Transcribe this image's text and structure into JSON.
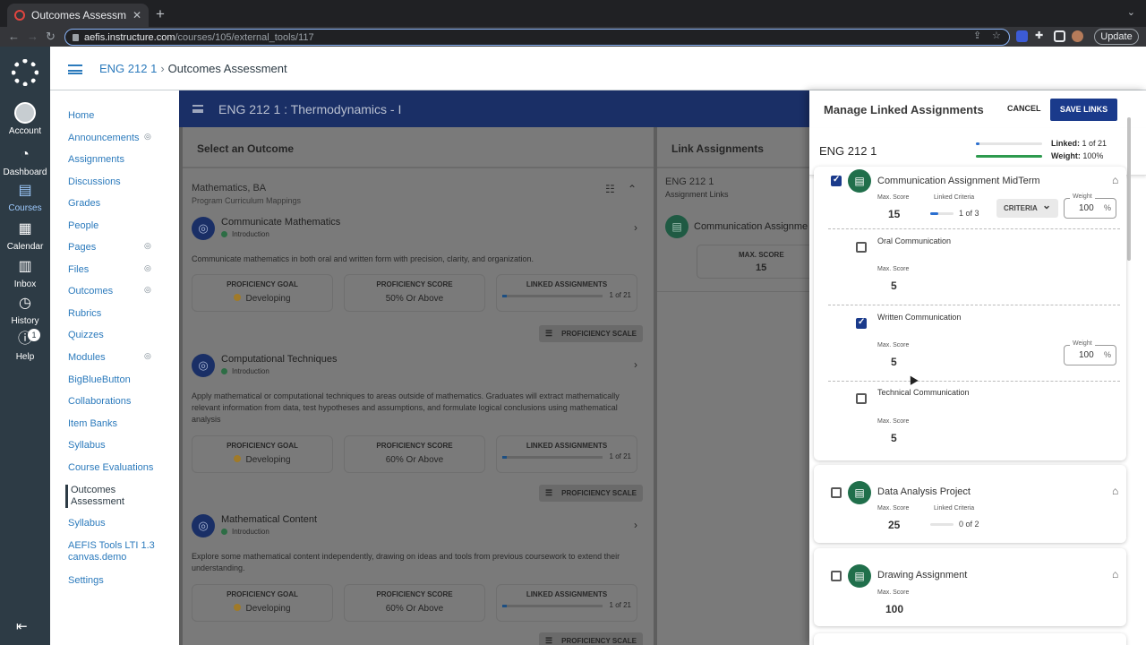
{
  "browser": {
    "tab_title": "Outcomes Assessment",
    "url_host": "aefis.instructure.com",
    "url_path": "/courses/105/external_tools/117",
    "update_label": "Update"
  },
  "global_nav": {
    "account": "Account",
    "dashboard": "Dashboard",
    "courses": "Courses",
    "calendar": "Calendar",
    "inbox": "Inbox",
    "history": "History",
    "help": "Help",
    "help_badge": "1"
  },
  "breadcrumb": {
    "course": "ENG 212 1",
    "separator": "›",
    "page": "Outcomes Assessment"
  },
  "course_nav": [
    {
      "label": "Home"
    },
    {
      "label": "Announcements"
    },
    {
      "label": "Assignments"
    },
    {
      "label": "Discussions"
    },
    {
      "label": "Grades"
    },
    {
      "label": "People"
    },
    {
      "label": "Pages"
    },
    {
      "label": "Files"
    },
    {
      "label": "Outcomes"
    },
    {
      "label": "Rubrics"
    },
    {
      "label": "Quizzes"
    },
    {
      "label": "Modules"
    },
    {
      "label": "BigBlueButton"
    },
    {
      "label": "Collaborations"
    },
    {
      "label": "Item Banks"
    },
    {
      "label": "Syllabus"
    },
    {
      "label": "Course Evaluations"
    },
    {
      "label": "Outcomes Assessment"
    },
    {
      "label": "Syllabus"
    },
    {
      "label": "AEFIS Tools LTI 1.3 canvas.demo"
    },
    {
      "label": "Settings"
    }
  ],
  "app_bar": {
    "title": "ENG 212 1 : Thermodynamics - I"
  },
  "left_panel": {
    "title": "Select an Outcome",
    "program": "Mathematics, BA",
    "program_sub": "Program Curriculum Mappings",
    "labels": {
      "goal": "PROFICIENCY GOAL",
      "score": "PROFICIENCY SCORE",
      "linked": "LINKED ASSIGNMENTS",
      "scale": "PROFICIENCY SCALE"
    },
    "outcomes": [
      {
        "title": "Communicate Mathematics",
        "level": "Introduction",
        "description": "Communicate mathematics in both oral and written form with precision, clarity, and organization.",
        "goal": "Developing",
        "score": "50% Or Above",
        "linked": "1 of 21",
        "linked_fraction": 0.048
      },
      {
        "title": "Computational Techniques",
        "level": "Introduction",
        "description": "Apply mathematical or computational techniques to areas outside of mathematics. Graduates will extract mathematically relevant information from data, test hypotheses and assumptions, and formulate logical conclusions using mathematical analysis",
        "goal": "Developing",
        "score": "60% Or Above",
        "linked": "1 of 21",
        "linked_fraction": 0.048
      },
      {
        "title": "Mathematical Content",
        "level": "Introduction",
        "description": "Explore some mathematical content independently, drawing on ideas and tools from previous coursework to extend their understanding.",
        "goal": "Developing",
        "score": "60% Or Above",
        "linked": "1 of 21",
        "linked_fraction": 0.048
      }
    ]
  },
  "right_panel": {
    "title": "Link Assignments",
    "course": "ENG 212 1",
    "sub": "Assignment Links",
    "assignment": "Communication Assignme",
    "max_label": "MAX. SCORE",
    "max_value": "15"
  },
  "drawer": {
    "title": "Manage Linked Assignments",
    "cancel": "CANCEL",
    "save": "SAVE LINKS",
    "course": "ENG 212 1",
    "linked_label": "Linked:",
    "linked_value": "1 of 21",
    "linked_fraction": 0.048,
    "weight_label": "Weight:",
    "weight_value": "100%",
    "weight_fraction": 1.0,
    "max_label": "Max. Score",
    "linked_criteria_label": "Linked Criteria",
    "weight_field_label": "Weight",
    "percent": "%",
    "criteria_button": "CRITERIA",
    "assignments": [
      {
        "title": "Communication Assignment MidTerm",
        "checked": true,
        "max": "15",
        "criteria": "1 of 3",
        "criteria_fraction": 0.33,
        "weight": "100",
        "criteria_items": [
          {
            "title": "Oral Communication",
            "checked": false,
            "max": "5"
          },
          {
            "title": "Written Communication",
            "checked": true,
            "max": "5",
            "weight": "100"
          },
          {
            "title": "Technical Communication",
            "checked": false,
            "max": "5"
          }
        ]
      },
      {
        "title": "Data Analysis Project",
        "checked": false,
        "max": "25",
        "criteria": "0 of 2",
        "criteria_fraction": 0
      },
      {
        "title": "Drawing Assignment",
        "checked": false,
        "max": "100"
      }
    ]
  }
}
